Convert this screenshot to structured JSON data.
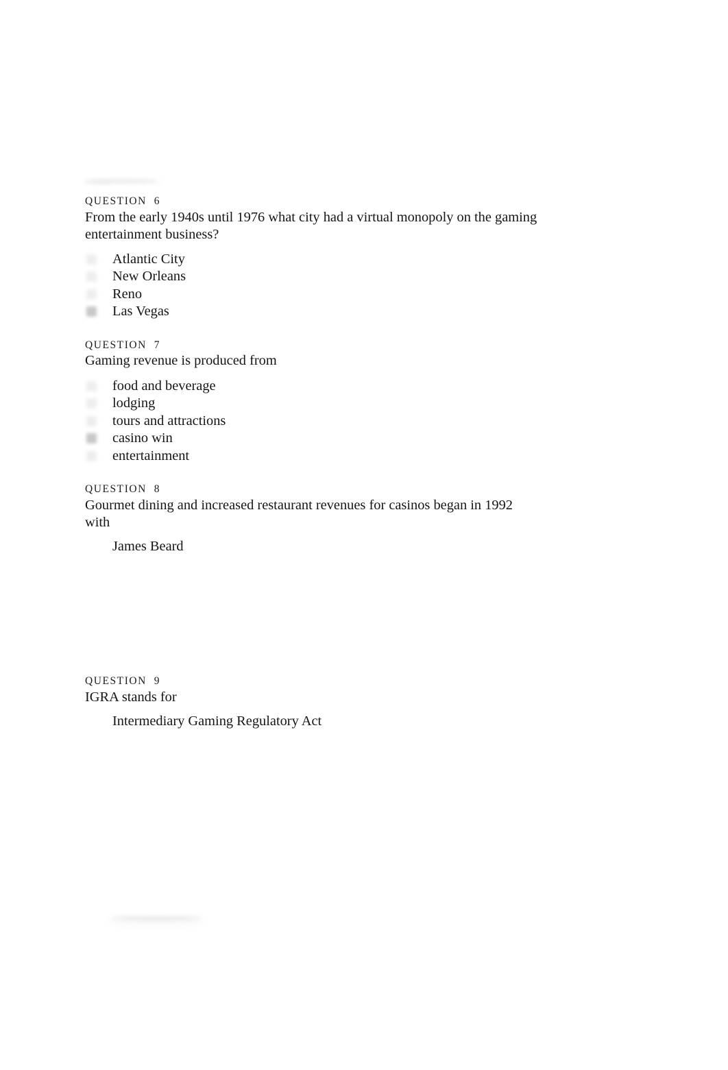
{
  "document": {
    "type": "quiz",
    "background_color": "#ffffff",
    "text_color": "#151515"
  },
  "questions": [
    {
      "header": "QUESTION  6",
      "prompt": "From the early 1940s until 1976 what city had a virtual monopoly on the gaming entertainment business?",
      "options": [
        {
          "label": "Atlantic City",
          "selected": false,
          "radio_visible": true
        },
        {
          "label": "New Orleans",
          "selected": false,
          "radio_visible": true
        },
        {
          "label": "Reno",
          "selected": false,
          "radio_visible": true
        },
        {
          "label": "Las Vegas",
          "selected": true,
          "radio_visible": true
        }
      ]
    },
    {
      "header": "QUESTION  7",
      "prompt": "Gaming revenue is produced from",
      "options": [
        {
          "label": "food and beverage",
          "selected": false,
          "radio_visible": true
        },
        {
          "label": "lodging",
          "selected": false,
          "radio_visible": true
        },
        {
          "label": "tours and attractions",
          "selected": false,
          "radio_visible": true
        },
        {
          "label": "casino win",
          "selected": true,
          "radio_visible": true
        },
        {
          "label": "entertainment",
          "selected": false,
          "radio_visible": true
        }
      ]
    },
    {
      "header": "QUESTION  8",
      "prompt": "Gourmet dining and increased restaurant revenues for casinos began in 1992 with",
      "options": [
        {
          "label": "James Beard",
          "selected": false,
          "radio_visible": false
        }
      ]
    },
    {
      "header": "QUESTION  9",
      "prompt": "IGRA stands for",
      "options": [
        {
          "label": "Intermediary Gaming Regulatory Act",
          "selected": false,
          "radio_visible": false
        }
      ]
    }
  ]
}
